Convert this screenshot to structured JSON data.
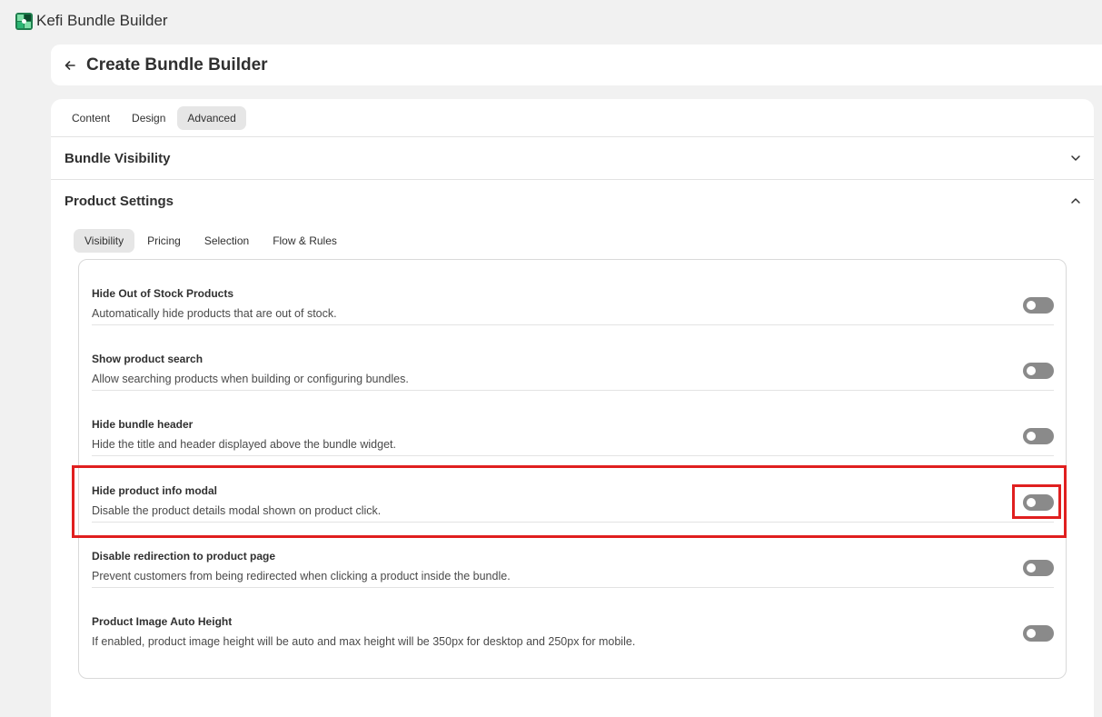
{
  "app": {
    "title": "Kefi Bundle Builder",
    "logo_icon": "kefi-logo-icon"
  },
  "header": {
    "title": "Create Bundle Builder",
    "back_icon": "arrow-left-icon"
  },
  "tabs": [
    {
      "label": "Content",
      "active": false
    },
    {
      "label": "Design",
      "active": false
    },
    {
      "label": "Advanced",
      "active": true
    }
  ],
  "sections": {
    "bundle_visibility": {
      "title": "Bundle Visibility",
      "expanded": false
    },
    "product_settings": {
      "title": "Product Settings",
      "expanded": true
    }
  },
  "subtabs": [
    {
      "label": "Visibility",
      "active": true
    },
    {
      "label": "Pricing",
      "active": false
    },
    {
      "label": "Selection",
      "active": false
    },
    {
      "label": "Flow & Rules",
      "active": false
    }
  ],
  "settings": [
    {
      "title": "Hide Out of Stock Products",
      "description": "Automatically hide products that are out of stock.",
      "enabled": false
    },
    {
      "title": "Show product search",
      "description": "Allow searching products when building or configuring bundles.",
      "enabled": false
    },
    {
      "title": "Hide bundle header",
      "description": "Hide the title and header displayed above the bundle widget.",
      "enabled": false
    },
    {
      "title": "Hide product info modal",
      "description": "Disable the product details modal shown on product click.",
      "enabled": false
    },
    {
      "title": "Disable redirection to product page",
      "description": "Prevent customers from being redirected when clicking a product inside the bundle.",
      "enabled": false
    },
    {
      "title": "Product Image Auto Height",
      "description": "If enabled, product image height will be auto and max height will be 350px for desktop and 250px for mobile.",
      "enabled": false
    }
  ],
  "colors": {
    "highlight": "#e01f1f",
    "toggle_off": "#8a8a8a",
    "brand_green": "#1a9b5a"
  }
}
